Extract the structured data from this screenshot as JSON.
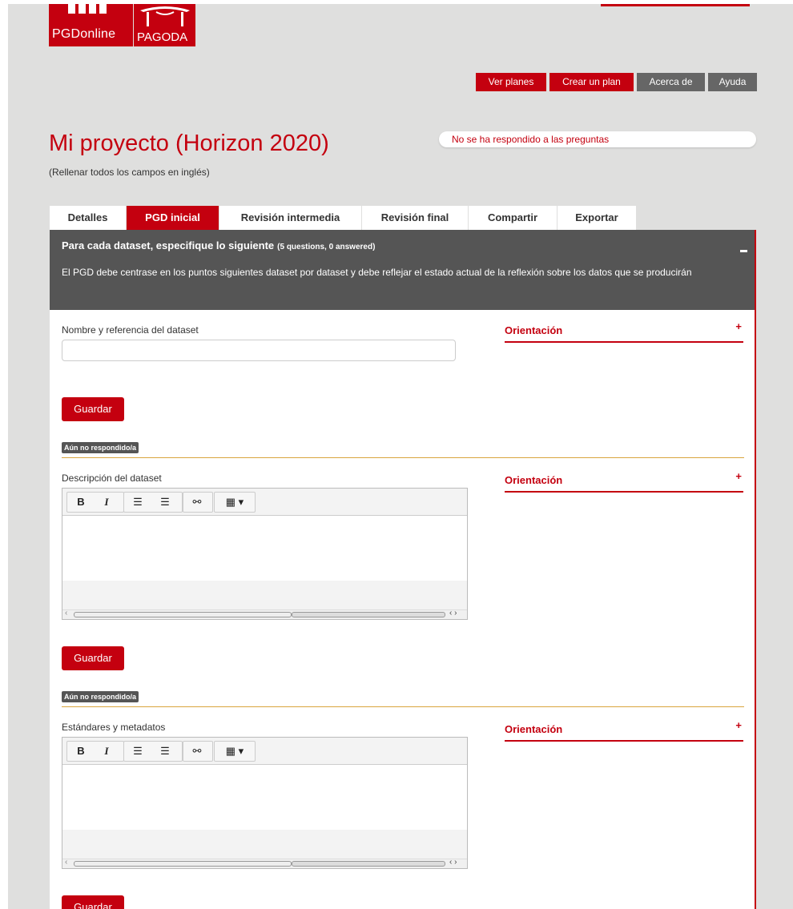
{
  "header": {
    "logo_pgd_text": "PGDonline",
    "logo_pagoda_text": "PAGODA",
    "nav": [
      {
        "label": "Ver planes",
        "style": "red"
      },
      {
        "label": "Crear un plan",
        "style": "red"
      },
      {
        "label": "Acerca de",
        "style": "grey"
      },
      {
        "label": "Ayuda",
        "style": "grey"
      }
    ]
  },
  "plan": {
    "title": "Mi proyecto (Horizon 2020)",
    "subtitle": "(Rellenar todos los campos en inglés)",
    "status": "No se ha respondido a las preguntas"
  },
  "tabs": [
    {
      "label": "Detalles",
      "active": false
    },
    {
      "label": "PGD inicial",
      "active": true
    },
    {
      "label": "Revisión intermedia",
      "active": false
    },
    {
      "label": "Revisión final",
      "active": false
    },
    {
      "label": "Compartir",
      "active": false
    },
    {
      "label": "Exportar",
      "active": false
    }
  ],
  "section": {
    "title": "Para cada dataset, especifique lo siguiente",
    "count": "(5 questions, 0 answered)",
    "description": "El PGD debe centrase en los puntos siguientes dataset por dataset y debe reflejar el estado actual de la reflexión sobre los datos que se producirán"
  },
  "questions": [
    {
      "label": "Nombre y referencia del dataset",
      "guidance": "Orientación",
      "save": "Guardar",
      "status": "Aún no respondido/a"
    },
    {
      "label": "Descripción del dataset",
      "guidance": "Orientación",
      "save": "Guardar",
      "status": "Aún no respondido/a"
    },
    {
      "label": "Estándares y metadatos",
      "guidance": "Orientación",
      "save": "Guardar"
    }
  ],
  "editor_toolbar": {
    "bold": "B",
    "italic": "I",
    "bullet_list_icon": "bullet-list-icon",
    "numbered_list_icon": "numbered-list-icon",
    "link_icon": "link-icon",
    "table_icon": "table-icon"
  },
  "colors": {
    "brand_red": "#c4000f",
    "background": "#dfdfde",
    "header_dark": "#555555",
    "divider_gold": "#d9a53e"
  }
}
